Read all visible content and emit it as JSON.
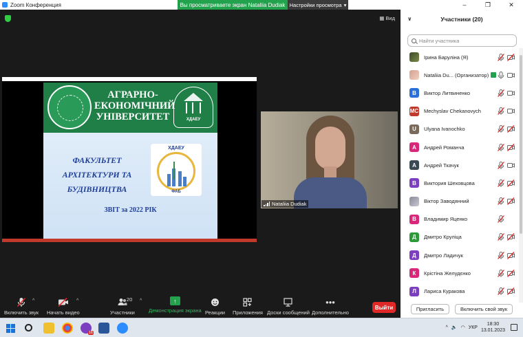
{
  "window": {
    "title": "Zoom Конференция",
    "share_banner": "Вы просматриваете экран Nataliia Dudiak",
    "view_options": "Настройки просмотра",
    "min": "–",
    "max": "❐",
    "close": "✕"
  },
  "meeting": {
    "view_label": "Вид"
  },
  "slide": {
    "window_title": "",
    "uni_title": "АГРАРНО-ЕКОНОМІЧНИЙ УНІВЕРСИТЕТ",
    "logo_abbr": "ХДАЕУ",
    "faculty": "ФАКУЛЬТЕТ АРХІТЕКТУРИ ТА БУДІВНИЦТВА",
    "fab_abbr": "ХДАЕУ",
    "fab_label": "ФАБ",
    "report": "ЗВІТ за 2022 РІК"
  },
  "video": {
    "name": "Nataliia Dudiak"
  },
  "toolbar": {
    "unmute": "Включить звук",
    "start_video": "Начать видео",
    "participants": "Участники",
    "participants_count": "20",
    "share": "Демонстрация экрана",
    "reactions": "Реакции",
    "apps": "Приложения",
    "whiteboards": "Доски сообщений",
    "more": "Дополнительно",
    "leave": "Выйти"
  },
  "panel": {
    "title": "Участники (20)",
    "search_placeholder": "Найти участника",
    "participants": [
      {
        "name": "Ірина Барулiна (Я)",
        "avatar": "",
        "avatar_color": "#5a6a3a",
        "photo": "photo",
        "mic": "muted",
        "cam": "off"
      },
      {
        "name": "Nataliia Du...  (Организатор)",
        "avatar": "",
        "avatar_color": "#d8a898",
        "photo": "photo2",
        "badge": true,
        "mic": "on",
        "cam": "on"
      },
      {
        "name": "Виктор Литвиненко",
        "avatar": "В",
        "avatar_color": "#2b6fd8",
        "mic": "muted",
        "cam": "on"
      },
      {
        "name": "Mechyslav Chekanovych",
        "avatar": "MC",
        "avatar_color": "#c0392b",
        "mic": "muted",
        "cam": "on"
      },
      {
        "name": "Ulyana Ivanochko",
        "avatar": "U",
        "avatar_color": "#7a6a5a",
        "mic": "muted",
        "cam": "off"
      },
      {
        "name": "Андрей Романча",
        "avatar": "А",
        "avatar_color": "#d9287a",
        "mic": "muted",
        "cam": "off"
      },
      {
        "name": "Андрей Ткачук",
        "avatar": "А",
        "avatar_color": "#3a4a55",
        "mic": "muted",
        "cam": "on"
      },
      {
        "name": "Виктория Шеховцова",
        "avatar": "В",
        "avatar_color": "#7b3fc0",
        "mic": "muted",
        "cam": "off"
      },
      {
        "name": "Віктор Заводянний",
        "avatar": "",
        "avatar_color": "#9a9aa8",
        "photo": "photo3",
        "mic": "muted",
        "cam": "off"
      },
      {
        "name": "Владимир Яценко",
        "avatar": "В",
        "avatar_color": "#d9287a",
        "mic": "muted",
        "cam": "none"
      },
      {
        "name": "Дмитро Круліца",
        "avatar": "Д",
        "avatar_color": "#2d9a3a",
        "mic": "muted",
        "cam": "off"
      },
      {
        "name": "Дмитро Ладичук",
        "avatar": "Д",
        "avatar_color": "#7b3fc0",
        "mic": "muted",
        "cam": "off"
      },
      {
        "name": "Крістіна Желудєнко",
        "avatar": "К",
        "avatar_color": "#d9287a",
        "mic": "muted",
        "cam": "off"
      },
      {
        "name": "Лариса Куракова",
        "avatar": "Л",
        "avatar_color": "#7b3fc0",
        "mic": "muted",
        "cam": "off"
      }
    ],
    "invite": "Пригласить",
    "unmute_self": "Включить свой звук"
  },
  "taskbar": {
    "lang": "УКР",
    "time": "18:30",
    "date": "13.01.2023",
    "badge": "16"
  }
}
